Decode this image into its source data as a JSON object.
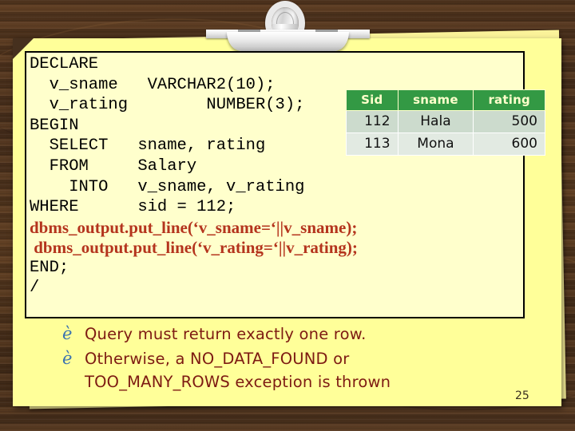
{
  "slide": {
    "page_number": "25",
    "background_color": "#4a3222",
    "paper_color": "#ffff99",
    "code_box_color": "#ffffcc"
  },
  "clip": {
    "name": "clipboard-clip"
  },
  "code": {
    "lines": [
      {
        "text": "DECLARE",
        "style": "plain"
      },
      {
        "text": "  v_sname   VARCHAR2(10);",
        "style": "plain"
      },
      {
        "text": "  v_rating        NUMBER(3);",
        "style": "plain"
      },
      {
        "text": "BEGIN",
        "style": "plain"
      },
      {
        "text": "  SELECT   sname, rating",
        "style": "plain"
      },
      {
        "text": "  FROM     Salary",
        "style": "plain"
      },
      {
        "text": "    INTO   v_sname, v_rating",
        "style": "plain"
      },
      {
        "text": "WHERE      sid = 112;",
        "style": "plain"
      },
      {
        "text": "dbms_output.put_line(‘v_sname=‘||v_sname);",
        "style": "emph"
      },
      {
        "text": " dbms_output.put_line(‘v_rating=‘||v_rating);",
        "style": "emph"
      },
      {
        "text": "END;",
        "style": "plain"
      },
      {
        "text": "/",
        "style": "plain"
      }
    ],
    "text_color": "#000000",
    "emph_color": "#b4341d"
  },
  "result_table": {
    "header_bg": "#339944",
    "header_fg": "#ffffcc",
    "columns": [
      "Sid",
      "sname",
      "rating"
    ],
    "rows": [
      {
        "Sid": "112",
        "sname": "Hala",
        "rating": "500"
      },
      {
        "Sid": "113",
        "sname": "Mona",
        "rating": "600"
      }
    ]
  },
  "bullets": {
    "glyph": "è",
    "glyph_color": "#3a72b0",
    "text_color": "#7d1a12",
    "items": [
      {
        "line1": "Query must return exactly one row.",
        "line2": ""
      },
      {
        "line1": "Otherwise, a NO_DATA_FOUND or",
        "line2": "TOO_MANY_ROWS exception is thrown"
      }
    ]
  }
}
